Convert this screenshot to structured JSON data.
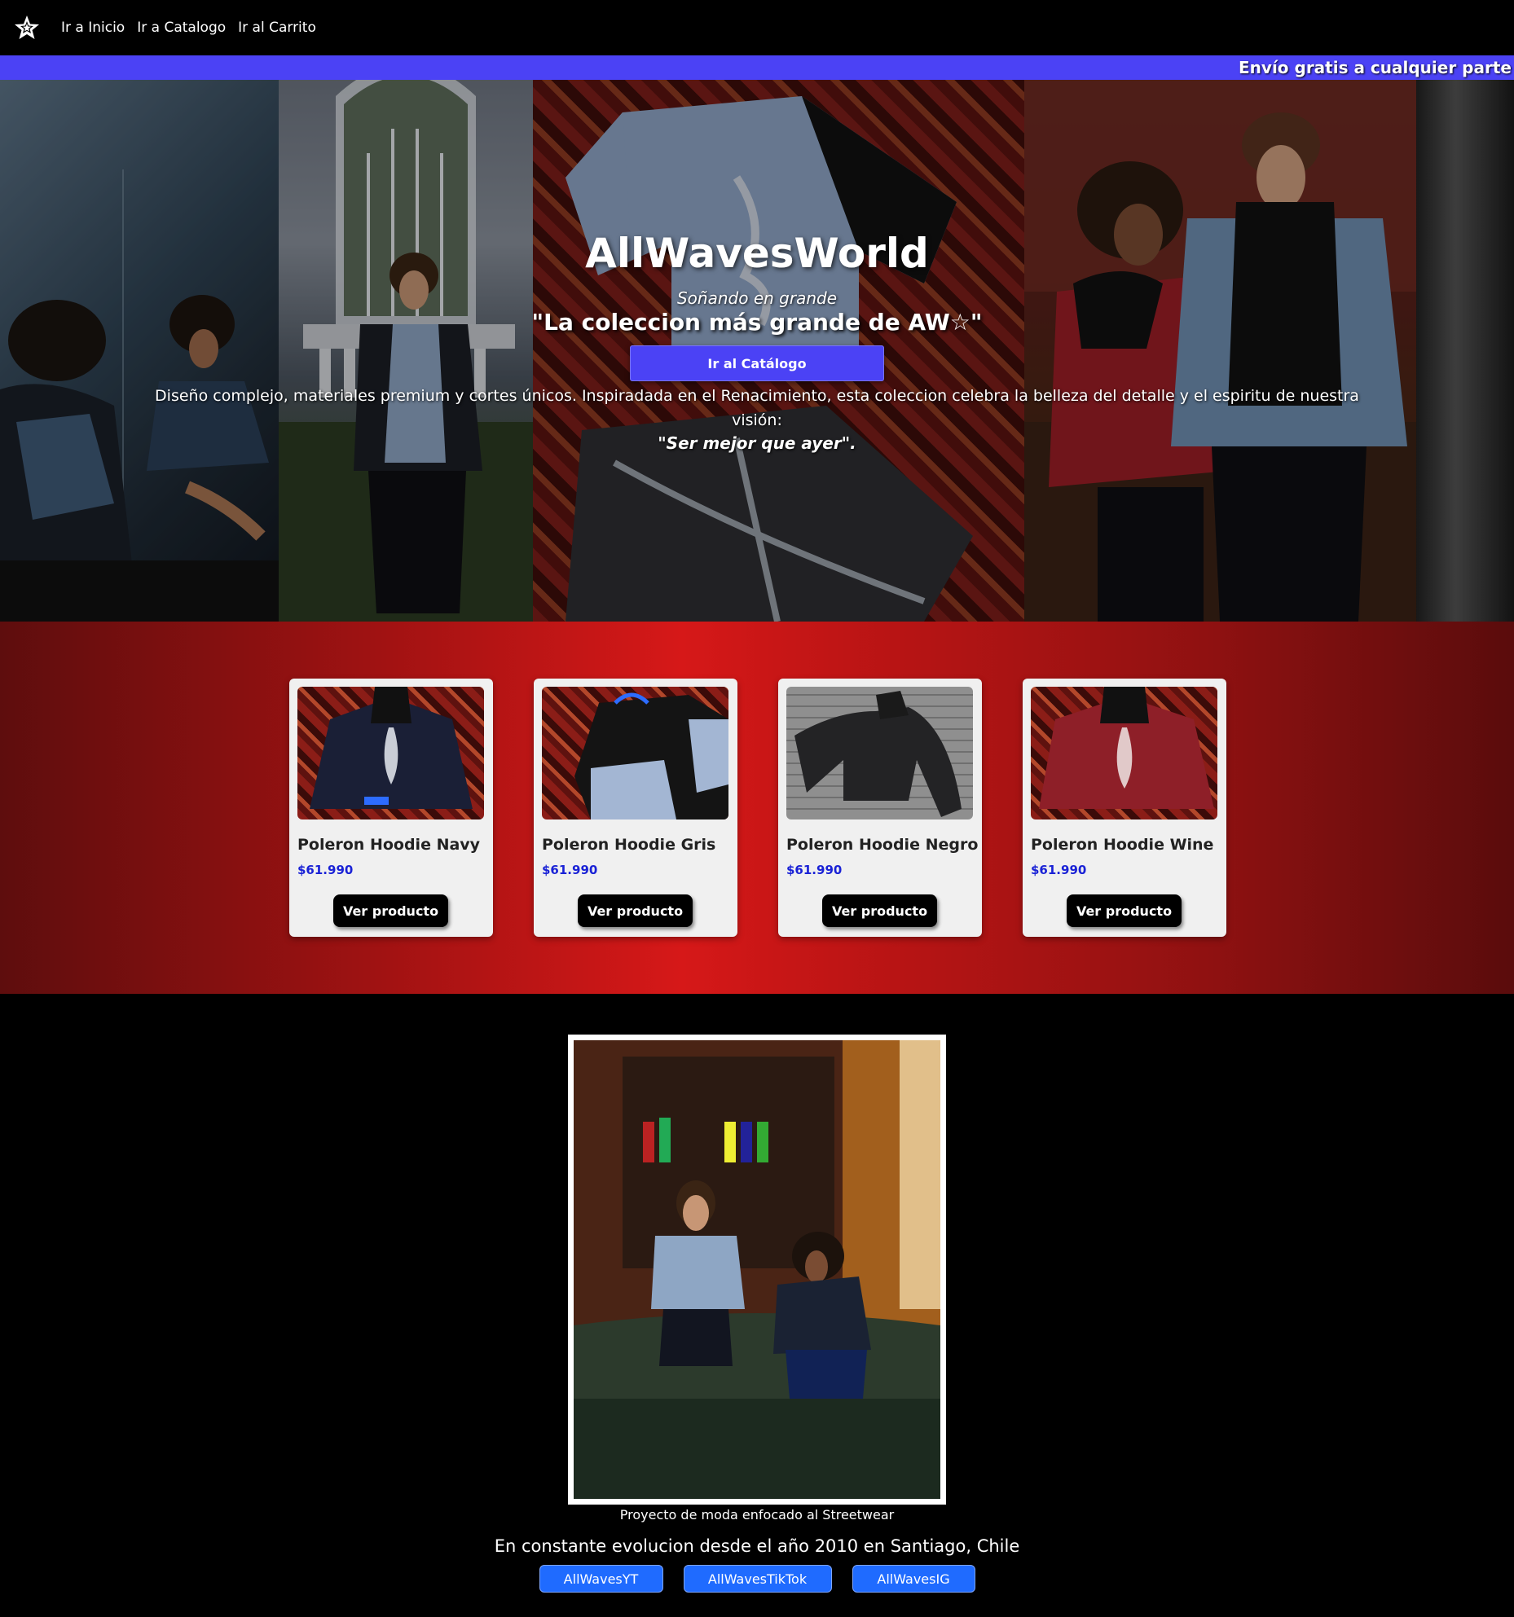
{
  "nav": {
    "logo_icon": "star-logo-icon",
    "links": [
      "Ir a Inicio",
      "Ir a Catalogo",
      "Ir al Carrito"
    ]
  },
  "banner": {
    "text": "Envío gratis a cualquier parte de"
  },
  "hero": {
    "title": "AllWavesWorld",
    "subtitle": "Soñando en grande",
    "quote": "\"La coleccion más grande de AW☆\"",
    "button_label": "Ir al Catálogo",
    "description": "Diseño complejo, materiales premium y cortes únicos. Inspiradada en el Renacimiento, esta coleccion celebra la belleza del detalle y el espiritu de nuestra visión:",
    "motto": "\"Ser mejor que ayer\"."
  },
  "products": [
    {
      "name": "Poleron Hoodie Navy",
      "price": "$61.990",
      "button": "Ver producto"
    },
    {
      "name": "Poleron Hoodie Gris",
      "price": "$61.990",
      "button": "Ver producto"
    },
    {
      "name": "Poleron Hoodie Negro",
      "price": "$61.990",
      "button": "Ver producto"
    },
    {
      "name": "Poleron Hoodie Wine",
      "price": "$61.990",
      "button": "Ver producto"
    }
  ],
  "about": {
    "caption": "Proyecto de moda enfocado al Streetwear",
    "tagline": "En constante evolucion desde el año 2010 en Santiago, Chile",
    "socials": [
      "AllWavesYT",
      "AllWavesTikTok",
      "AllWavesIG"
    ]
  },
  "colors": {
    "accent": "#4b42f5",
    "price": "#1a22d6",
    "section_red": "#d61818",
    "social_blue": "#1f6bff"
  }
}
